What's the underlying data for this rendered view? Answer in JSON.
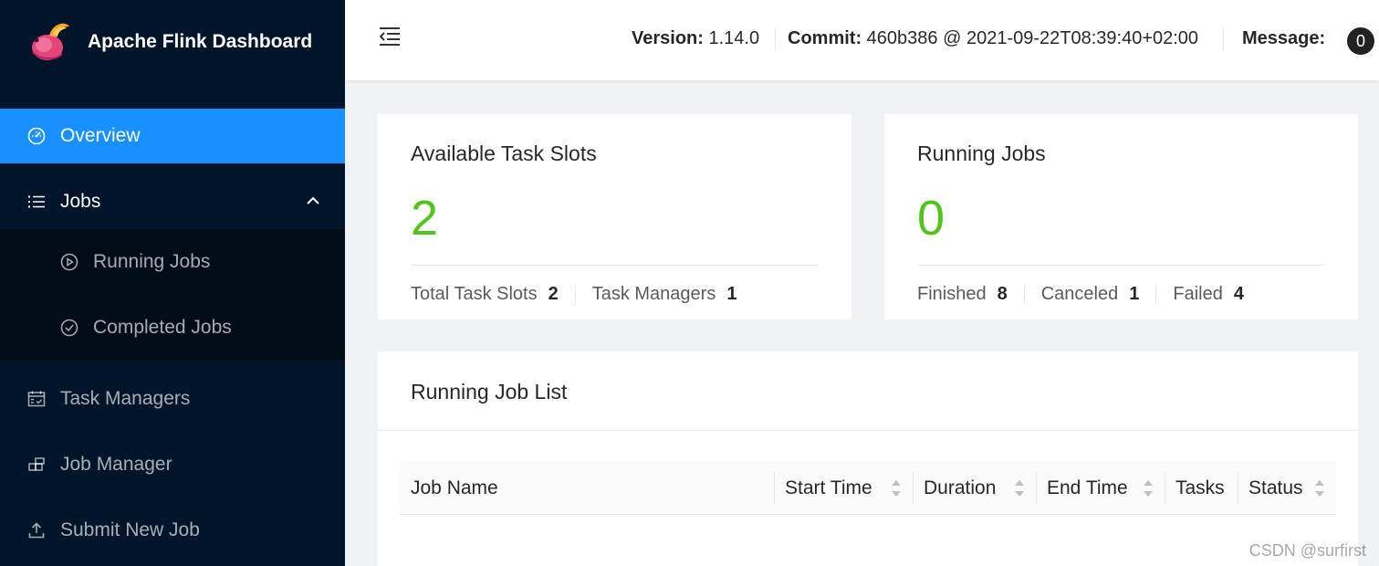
{
  "brand": {
    "title": "Apache Flink Dashboard"
  },
  "sidebar": {
    "items": [
      {
        "label": "Overview",
        "icon": "dashboard-icon"
      },
      {
        "label": "Jobs",
        "icon": "list-icon"
      },
      {
        "label": "Running Jobs",
        "icon": "play-circle-icon"
      },
      {
        "label": "Completed Jobs",
        "icon": "check-circle-icon"
      },
      {
        "label": "Task Managers",
        "icon": "schedule-icon"
      },
      {
        "label": "Job Manager",
        "icon": "cluster-icon"
      },
      {
        "label": "Submit New Job",
        "icon": "upload-icon"
      }
    ]
  },
  "header": {
    "version_label": "Version:",
    "version_value": "1.14.0",
    "commit_label": "Commit:",
    "commit_value": "460b386 @ 2021-09-22T08:39:40+02:00",
    "message_label": "Message:",
    "message_count": "0"
  },
  "slots_card": {
    "title": "Available Task Slots",
    "value": "2",
    "total_label": "Total Task Slots",
    "total_value": "2",
    "tm_label": "Task Managers",
    "tm_value": "1"
  },
  "jobs_card": {
    "title": "Running Jobs",
    "value": "0",
    "finished_label": "Finished",
    "finished_value": "8",
    "canceled_label": "Canceled",
    "canceled_value": "1",
    "failed_label": "Failed",
    "failed_value": "4"
  },
  "job_list": {
    "title": "Running Job List",
    "columns": [
      "Job Name",
      "Start Time",
      "Duration",
      "End Time",
      "Tasks",
      "Status"
    ]
  },
  "watermark": "CSDN @surfirst",
  "colors": {
    "sidebar": "#001529",
    "active": "#1890ff",
    "number": "#52c41a"
  }
}
